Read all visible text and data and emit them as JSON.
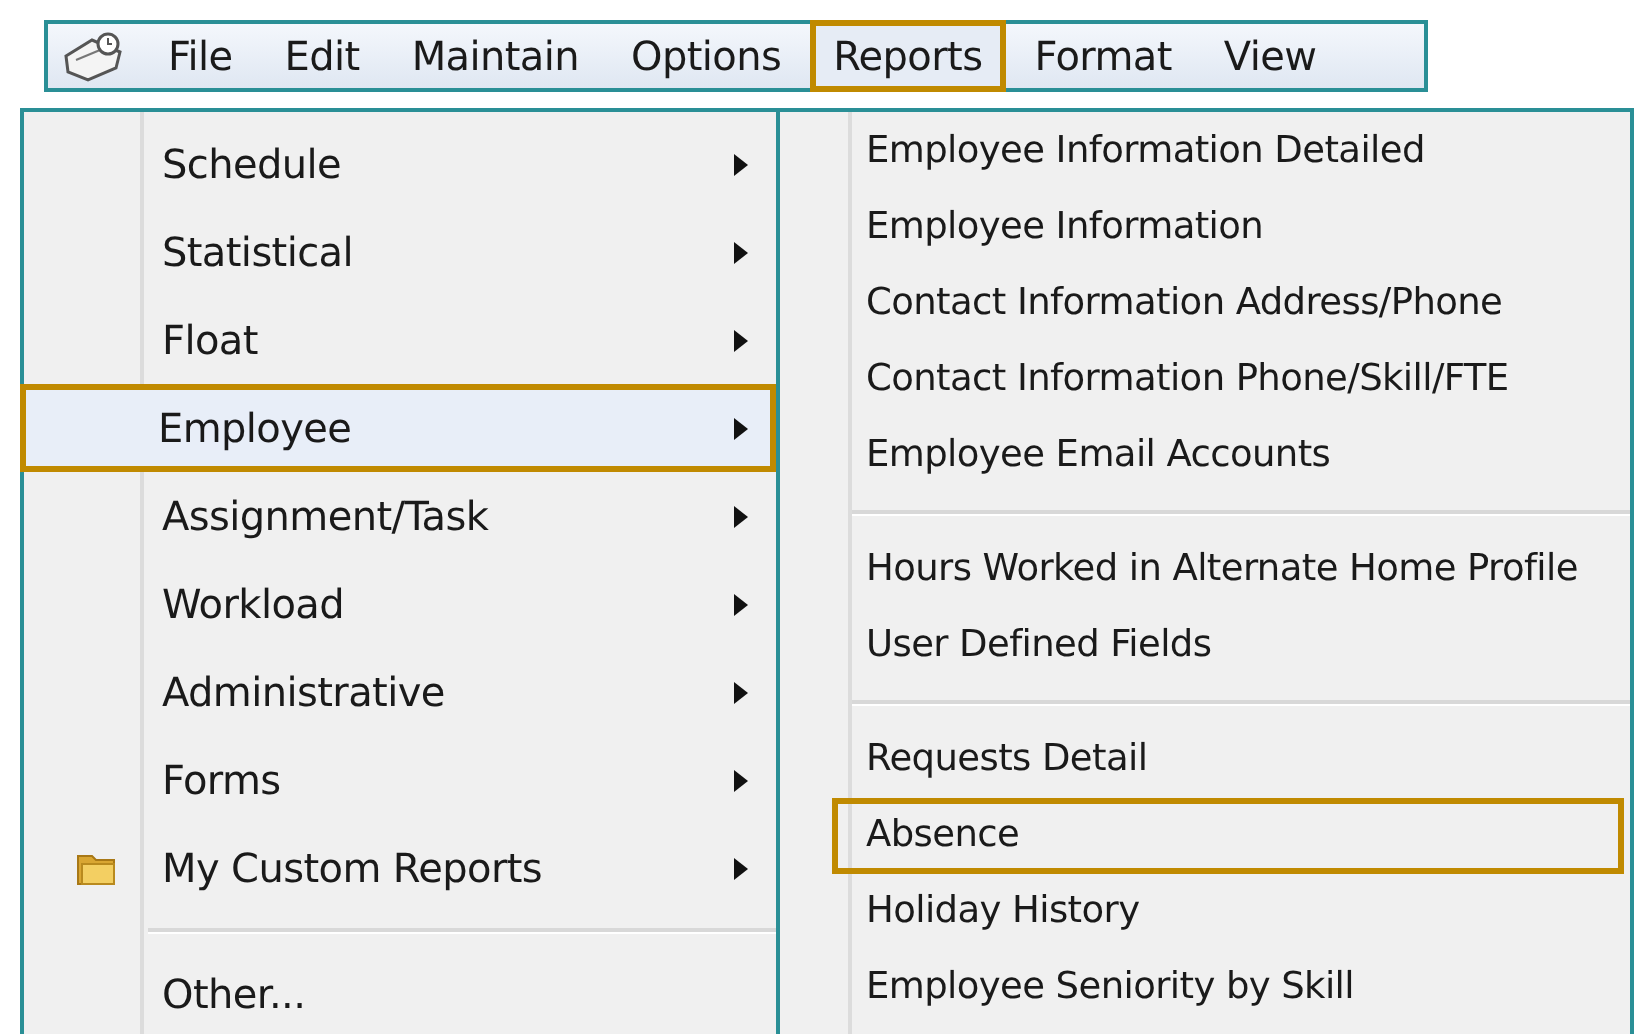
{
  "menu_bar": {
    "items": [
      {
        "label": "File",
        "selected": false
      },
      {
        "label": "Edit",
        "selected": false
      },
      {
        "label": "Maintain",
        "selected": false
      },
      {
        "label": "Options",
        "selected": false
      },
      {
        "label": "Reports",
        "selected": true
      },
      {
        "label": "Format",
        "selected": false
      },
      {
        "label": "View",
        "selected": false
      }
    ]
  },
  "reports_menu": {
    "groups": [
      [
        {
          "label": "Schedule",
          "kind": "plain",
          "has_submenu": true,
          "selected": false
        },
        {
          "label": "Statistical",
          "kind": "plain",
          "has_submenu": true,
          "selected": false
        },
        {
          "label": "Float",
          "kind": "plain",
          "has_submenu": true,
          "selected": false
        },
        {
          "label": "Employee",
          "kind": "plain",
          "has_submenu": true,
          "selected": true
        },
        {
          "label": "Assignment/Task",
          "kind": "plain",
          "has_submenu": true,
          "selected": false
        },
        {
          "label": "Workload",
          "kind": "plain",
          "has_submenu": true,
          "selected": false
        },
        {
          "label": "Administrative",
          "kind": "plain",
          "has_submenu": true,
          "selected": false
        },
        {
          "label": "Forms",
          "kind": "plain",
          "has_submenu": true,
          "selected": false
        },
        {
          "label": "My Custom Reports",
          "kind": "folder",
          "has_submenu": true,
          "selected": false
        }
      ],
      [
        {
          "label": "Other...",
          "kind": "plain",
          "has_submenu": false,
          "selected": false
        }
      ]
    ]
  },
  "employee_submenu": {
    "groups": [
      [
        {
          "label": "Employee Information Detailed",
          "selected": false
        },
        {
          "label": "Employee Information",
          "selected": false
        },
        {
          "label": "Contact Information Address/Phone",
          "selected": false
        },
        {
          "label": "Contact Information Phone/Skill/FTE",
          "selected": false
        },
        {
          "label": "Employee Email Accounts",
          "selected": false
        }
      ],
      [
        {
          "label": "Hours Worked in Alternate Home Profile",
          "selected": false
        },
        {
          "label": "User Defined Fields",
          "selected": false
        }
      ],
      [
        {
          "label": "Requests Detail",
          "selected": false
        },
        {
          "label": "Absence",
          "selected": true
        },
        {
          "label": "Holiday History",
          "selected": false
        },
        {
          "label": "Employee Seniority by Skill",
          "selected": false
        }
      ]
    ]
  }
}
